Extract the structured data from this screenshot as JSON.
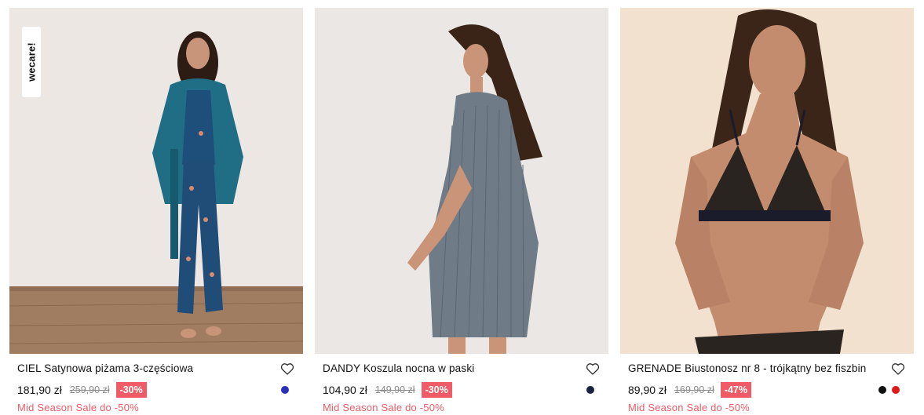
{
  "products": [
    {
      "badge": "wecare!",
      "title": "CIEL Satynowa piżama 3-częściowa",
      "price": "181,90 zł",
      "old_price": "259,90 zł",
      "discount": "-30%",
      "promo": "Mid Season Sale do -50%",
      "swatches": [
        "#2b2fb8"
      ],
      "image": "model-satin-pajama-set"
    },
    {
      "title": "DANDY Koszula nocna w paski",
      "price": "104,90 zł",
      "old_price": "149,90 zł",
      "discount": "-30%",
      "promo": "Mid Season Sale do -50%",
      "swatches": [
        "#1b2240"
      ],
      "image": "model-striped-nightshirt"
    },
    {
      "title": "GRENADE Biustonosz nr 8 - trójkątny bez fiszbin",
      "price": "89,90 zł",
      "old_price": "169,90 zł",
      "discount": "-47%",
      "promo": "Mid Season Sale do -50%",
      "swatches": [
        "#111111",
        "#e01818"
      ],
      "image": "model-lace-triangle-bra"
    }
  ],
  "icons": {
    "wishlist": "heart-outline-icon"
  },
  "colors": {
    "discount_bg": "#ef5b66",
    "promo_text": "#ef5b66"
  }
}
